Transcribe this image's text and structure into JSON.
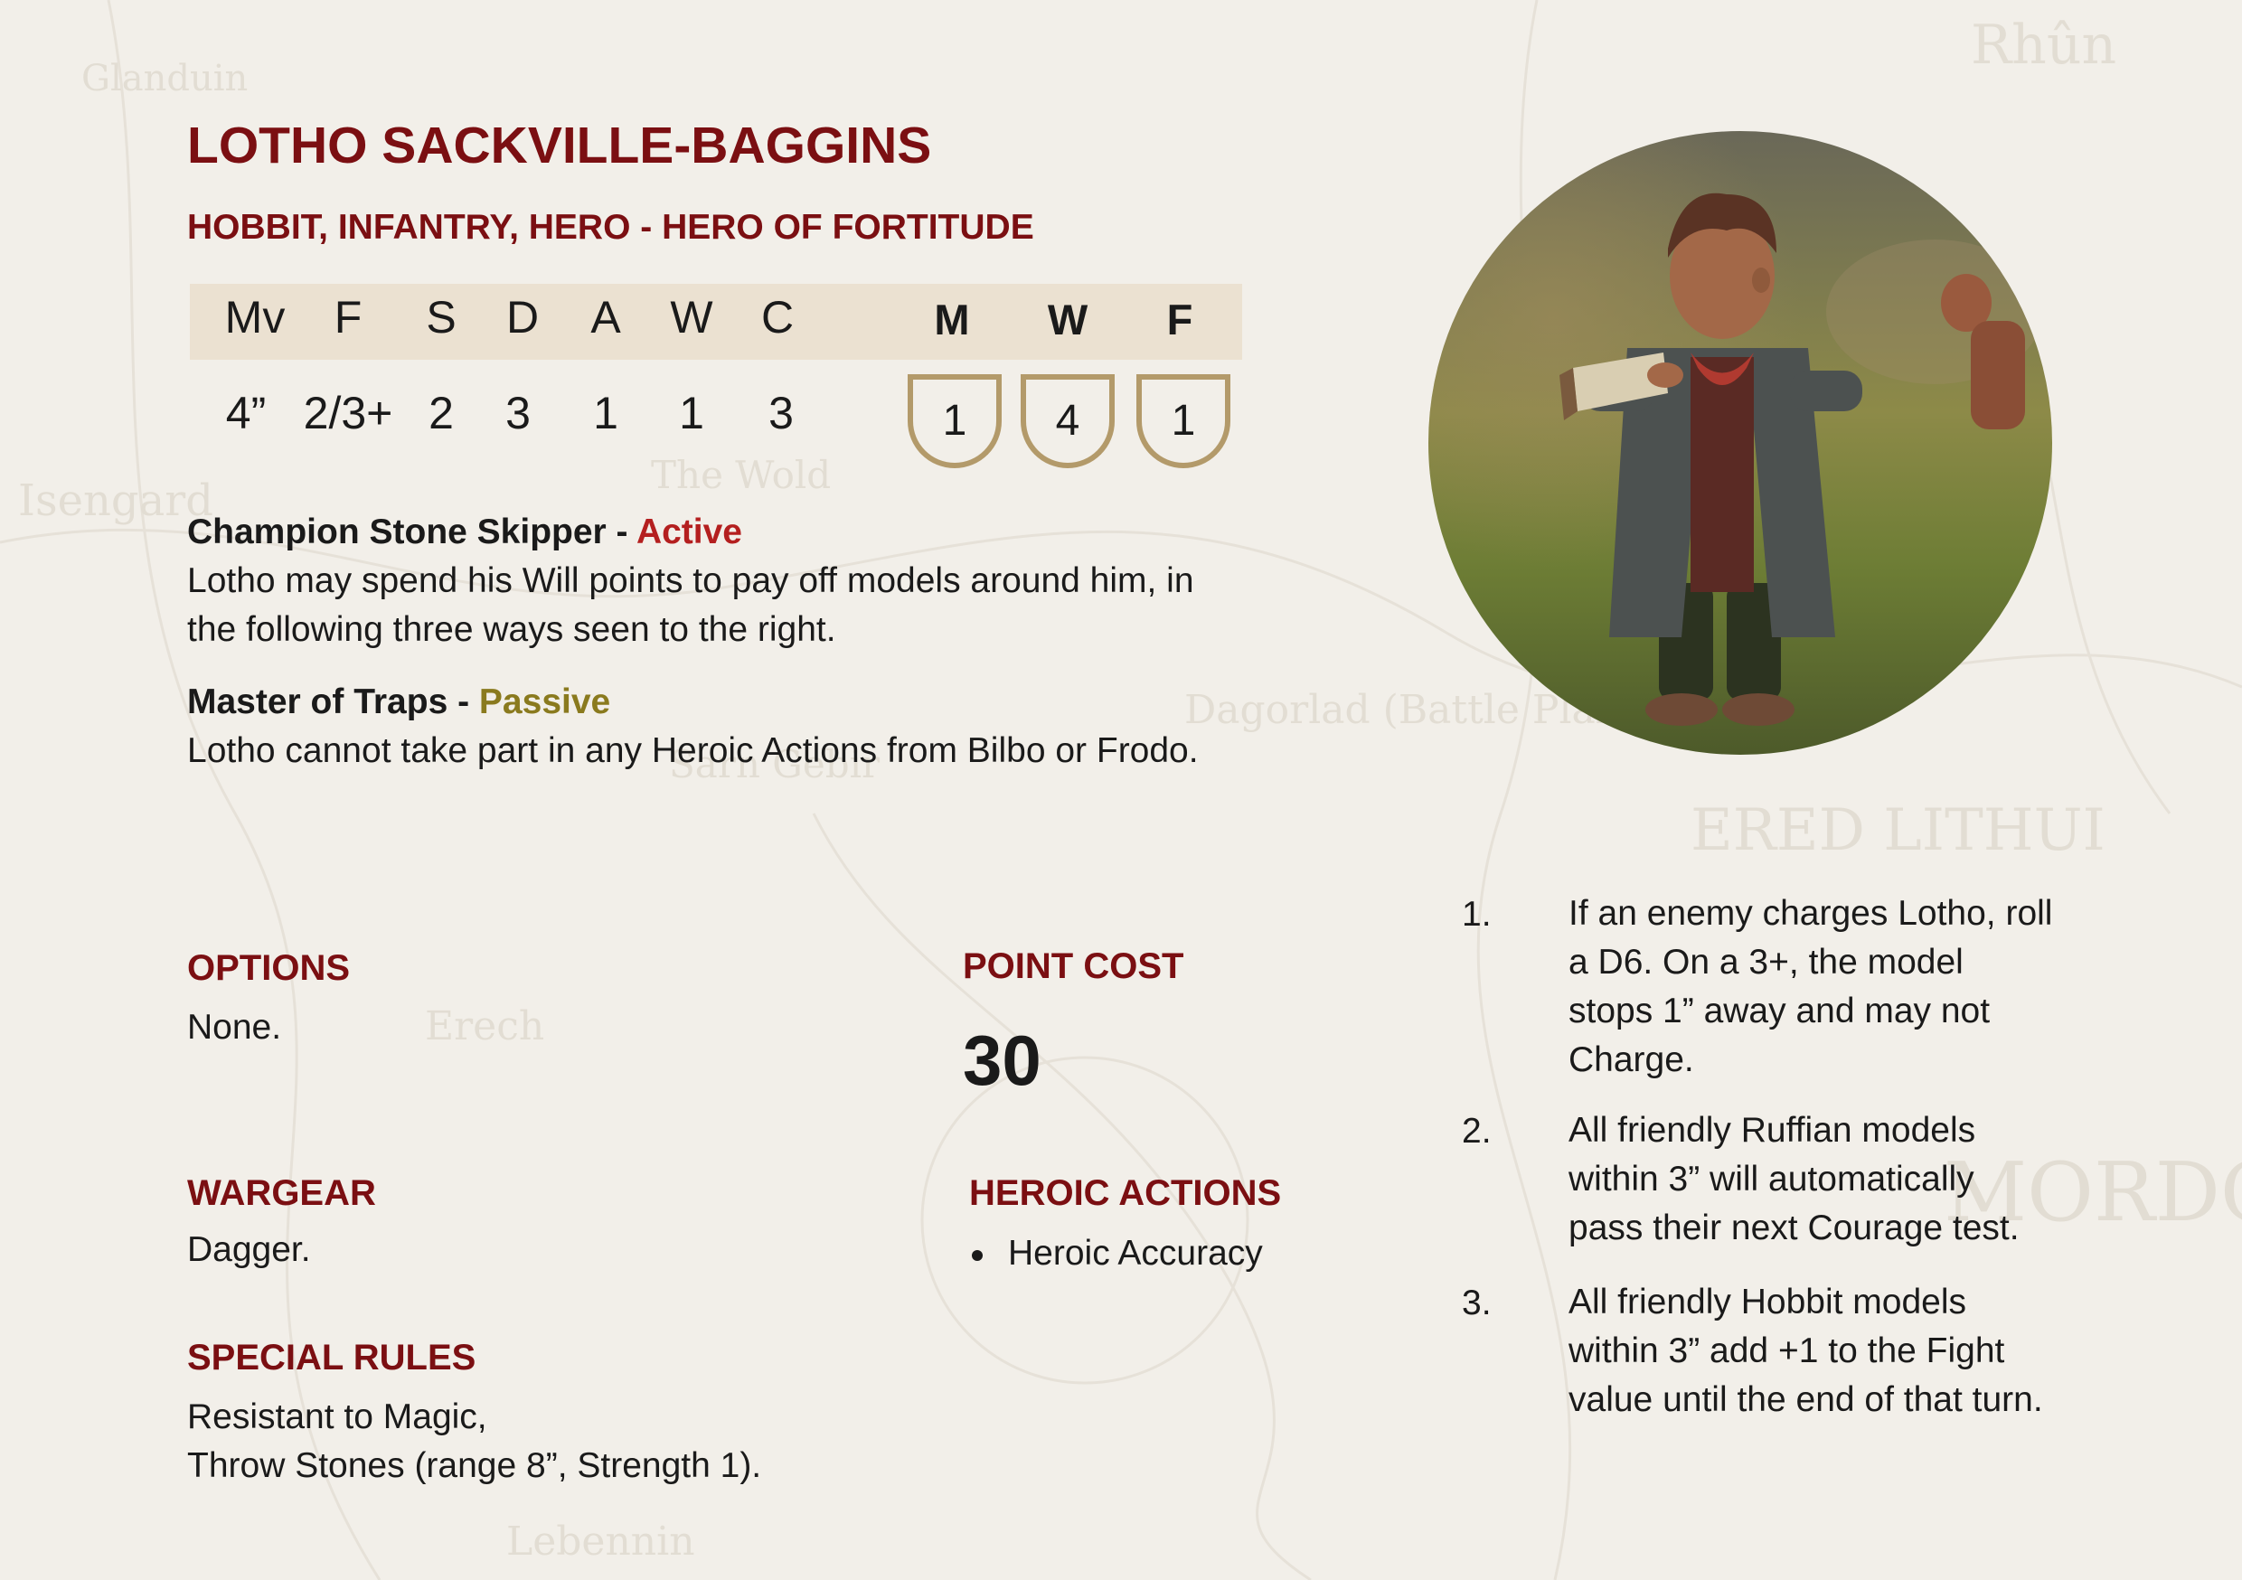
{
  "card": {
    "title": "LOTHO SACKVILLE-BAGGINS",
    "keywords": "HOBBIT, INFANTRY, HERO - HERO OF FORTITUDE"
  },
  "stats": {
    "headers": [
      "Mv",
      "F",
      "S",
      "D",
      "A",
      "W",
      "C",
      "M",
      "W",
      "F"
    ],
    "values": [
      "4”",
      "2/3+",
      "2",
      "3",
      "1",
      "1",
      "3"
    ],
    "mwf": [
      "1",
      "4",
      "1"
    ]
  },
  "rules": [
    {
      "name": "Champion Stone Skipper - ",
      "type": "Active",
      "lines": [
        "Lotho may spend his Will points to pay off models around him, in",
        "the following three ways seen to the right."
      ]
    },
    {
      "name": "Master of Traps - ",
      "type": "Passive",
      "lines": [
        "Lotho cannot take part in any Heroic Actions from Bilbo or Frodo."
      ]
    }
  ],
  "options": {
    "heading": "OPTIONS",
    "value": "None."
  },
  "point_cost": {
    "heading": "POINT COST",
    "value": "30"
  },
  "wargear": {
    "heading": "WARGEAR",
    "value": "Dagger."
  },
  "heroic_actions": {
    "heading": "HEROIC ACTIONS",
    "items": [
      "Heroic Accuracy"
    ]
  },
  "special_rules": {
    "heading": "SPECIAL RULES",
    "lines": [
      "Resistant to Magic,",
      "Throw Stones (range 8”, Strength 1)."
    ]
  },
  "ways": [
    {
      "num": "1.",
      "lines": [
        "If an enemy charges Lotho, roll",
        "a D6. On a 3+, the model",
        "stops 1” away and may not",
        "Charge."
      ]
    },
    {
      "num": "2.",
      "lines": [
        "All friendly Ruffian models",
        "within 3” will automatically",
        "pass their next Courage test."
      ]
    },
    {
      "num": "3.",
      "lines": [
        "All friendly Hobbit models",
        "within 3” add +1 to the Fight",
        "value until the end of that turn."
      ]
    }
  ],
  "colors": {
    "accent": "#7b0f12",
    "active": "#b41f1f",
    "passive": "#8a7a1e",
    "band": "#ebe1d1",
    "shield": "#b39a6a",
    "paper": "#f2efe9"
  }
}
